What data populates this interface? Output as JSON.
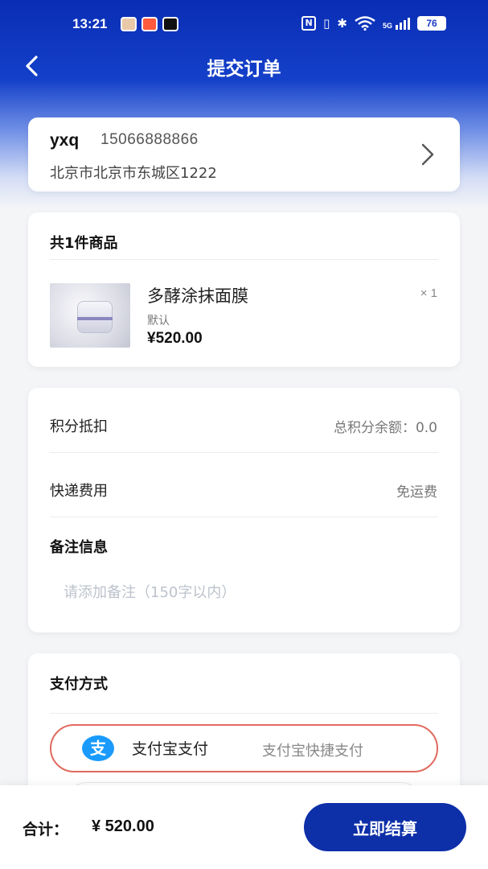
{
  "status_bar": {
    "time": "13:21",
    "signal": "5G",
    "battery": "76"
  },
  "header": {
    "title": "提交订单"
  },
  "address": {
    "name": "yxq",
    "phone": "15066888866",
    "detail": "北京市北京市东城区1222"
  },
  "goods": {
    "count_text": "共1件商品",
    "items": [
      {
        "name": "多酵涂抹面膜",
        "spec": "默认",
        "price": "¥520.00",
        "quantity": "× 1"
      }
    ]
  },
  "info": {
    "points_label": "积分抵扣",
    "points_value": "总积分余额：0.0",
    "shipping_label": "快递费用",
    "shipping_value": "免运费",
    "remark_title": "备注信息",
    "remark_placeholder": "请添加备注（150字以内）"
  },
  "payment": {
    "title": "支付方式",
    "options": [
      {
        "name": "支付宝支付",
        "desc": "支付宝快捷支付",
        "icon": "alipay-icon",
        "selected": true
      }
    ]
  },
  "footer": {
    "total_label": "合计：",
    "total_amount": "¥ 520.00",
    "checkout_label": "立即结算"
  },
  "colors": {
    "primary": "#0d2fa8",
    "header_blue": "#0a2db5",
    "selected_border": "#e06a5e",
    "alipay": "#1a9bfc"
  }
}
